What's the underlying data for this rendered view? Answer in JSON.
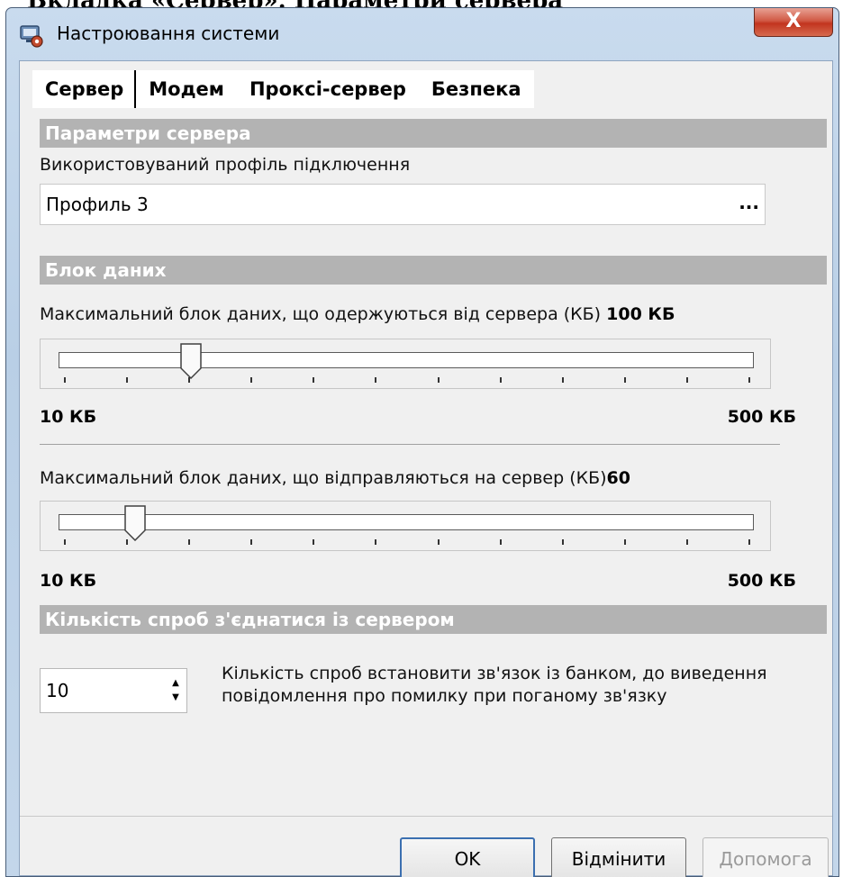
{
  "document_top_text": "Вкладка «Сервер». Параметри сервера",
  "window": {
    "title": "Настроювання системи",
    "close_label": "X"
  },
  "tabs": [
    {
      "label": "Сервер",
      "active": true
    },
    {
      "label": "Модем",
      "active": false
    },
    {
      "label": "Проксі-сервер",
      "active": false
    },
    {
      "label": "Безпека",
      "active": false
    }
  ],
  "server_params": {
    "header": "Параметри сервера",
    "profile_label": "Використовуваний профіль підключення",
    "profile_value": "Профиль 3",
    "browse_label": "..."
  },
  "data_block": {
    "header": "Блок даних",
    "receive": {
      "label": "Максимальний блок даних, що одержуються від сервера (КБ)",
      "value_text": "100 КБ",
      "min_label": "10 КБ",
      "max_label": "500 КБ",
      "position_fraction": 0.19
    },
    "send": {
      "label": "Максимальний блок даних, що відправляються на сервер (КБ)",
      "value_text": "60",
      "min_label": "10 КБ",
      "max_label": "500 КБ",
      "position_fraction": 0.11
    }
  },
  "retries": {
    "header": "Кількість спроб з'єднатися із сервером",
    "value": "10",
    "description": "Кількість спроб встановити зв'язок із банком, до виведення повідомлення про помилку при поганому зв'язку"
  },
  "buttons": {
    "ok": "OK",
    "cancel": "Відмінити",
    "help": "Допомога"
  }
}
